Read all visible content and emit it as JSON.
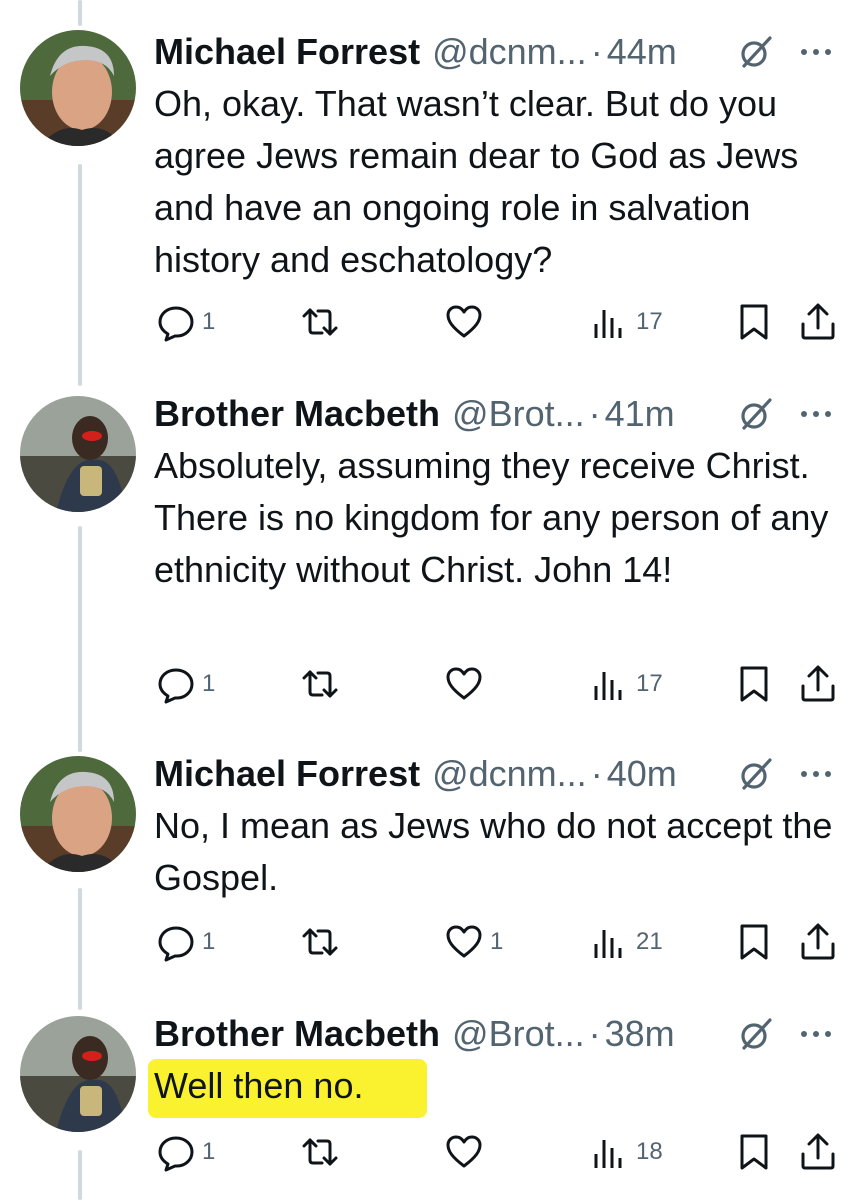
{
  "tweets": [
    {
      "name": "Michael Forrest",
      "handle": "@dcnm...",
      "separator": "·",
      "time": "44m",
      "text": "Oh, okay.  That wasn’t clear. But do you agree Jews remain dear to God as Jews and have an ongoing role in salvation history and eschatology?",
      "reply_count": "1",
      "retweet_count": "",
      "like_count": "",
      "view_count": "17",
      "avatar": "avatar-michael"
    },
    {
      "name": "Brother Macbeth",
      "handle": "@Brot...",
      "separator": "·",
      "time": "41m",
      "text": "Absolutely, assuming they receive Christ. There is no kingdom for any person of any ethnicity without Christ. John 14!",
      "reply_count": "1",
      "retweet_count": "",
      "like_count": "",
      "view_count": "17",
      "avatar": "avatar-macbeth"
    },
    {
      "name": "Michael Forrest",
      "handle": "@dcnm...",
      "separator": "·",
      "time": "40m",
      "text": "No, I mean as Jews who do not accept the Gospel.",
      "reply_count": "1",
      "retweet_count": "",
      "like_count": "1",
      "view_count": "21",
      "avatar": "avatar-michael"
    },
    {
      "name": "Brother Macbeth",
      "handle": "@Brot...",
      "separator": "·",
      "time": "38m",
      "text": "Well then no.",
      "reply_count": "1",
      "retweet_count": "",
      "like_count": "",
      "view_count": "18",
      "avatar": "avatar-macbeth",
      "highlighted": true
    }
  ],
  "icons": {
    "reply": "reply-icon",
    "retweet": "retweet-icon",
    "like": "heart-icon",
    "views": "views-icon",
    "bookmark": "bookmark-icon",
    "share": "share-icon",
    "grok": "grok-icon",
    "more": "more-icon"
  },
  "colors": {
    "text": "#0f1419",
    "secondary": "#536471",
    "thread_line": "#cfd9de",
    "highlight": "#faf22f"
  }
}
